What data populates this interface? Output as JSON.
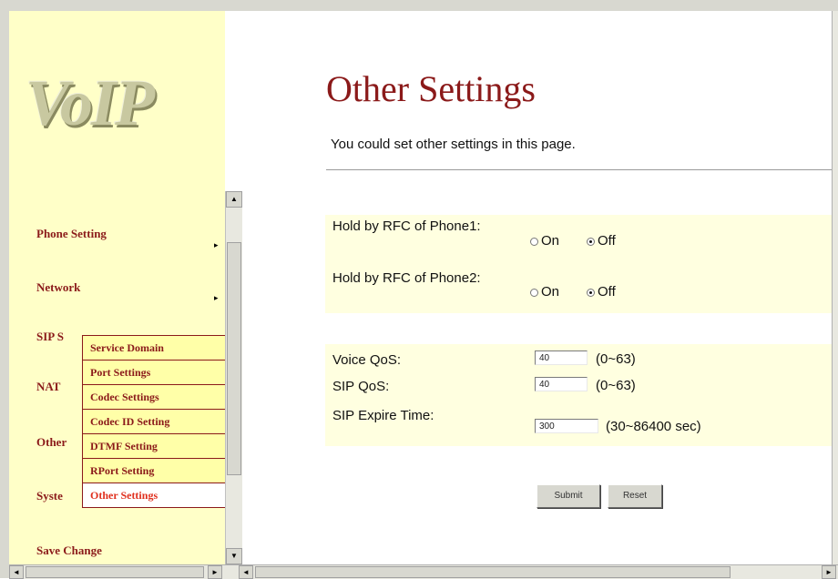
{
  "logo": "VoIP",
  "nav": {
    "items": [
      {
        "label": "Phone Setting"
      },
      {
        "label": "Network"
      },
      {
        "label": "SIP S"
      },
      {
        "label": "NAT"
      },
      {
        "label": "Other"
      },
      {
        "label": "Syste"
      },
      {
        "label": "Save Change"
      }
    ],
    "submenu": [
      {
        "label": "Service Domain"
      },
      {
        "label": "Port Settings"
      },
      {
        "label": "Codec Settings"
      },
      {
        "label": "Codec ID Setting"
      },
      {
        "label": "DTMF Setting"
      },
      {
        "label": "RPort Setting"
      },
      {
        "label": "Other Settings"
      }
    ]
  },
  "page": {
    "title": "Other Settings",
    "subtitle": "You could set other settings in this page."
  },
  "form": {
    "hold1": {
      "label": "Hold by RFC of Phone1:",
      "on": "On",
      "off": "Off",
      "selected": "Off"
    },
    "hold2": {
      "label": "Hold by RFC of Phone2:",
      "on": "On",
      "off": "Off",
      "selected": "Off"
    },
    "voice_qos": {
      "label": "Voice QoS:",
      "value": "40",
      "hint": "(0~63)"
    },
    "sip_qos": {
      "label": "SIP QoS:",
      "value": "40",
      "hint": "(0~63)"
    },
    "sip_expire": {
      "label": "SIP Expire Time:",
      "value": "300",
      "hint": "(30~86400 sec)"
    },
    "submit_label": "Submit",
    "reset_label": "Reset"
  },
  "scroll_arrows": {
    "up": "▲",
    "down": "▼",
    "left": "◄",
    "right": "►"
  }
}
